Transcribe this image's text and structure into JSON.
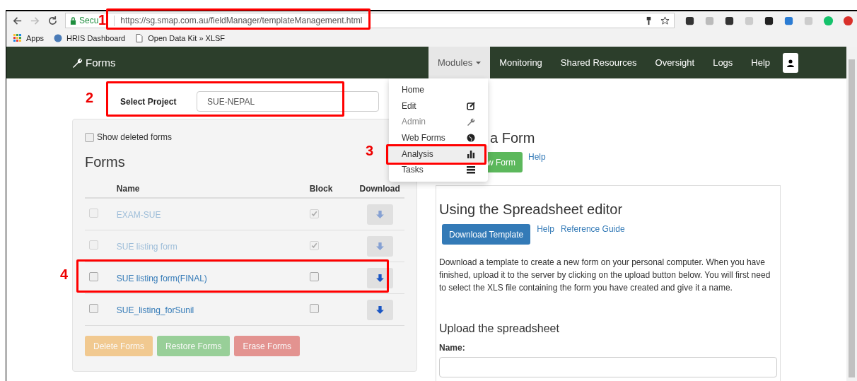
{
  "browser": {
    "secure_label": "Secu",
    "url": "https://sg.smap.com.au/fieldManager/templateManagement.html",
    "bookmarks": [
      "Apps",
      "HRIS Dashboard",
      "Open Data Kit » XLSF"
    ]
  },
  "navbar": {
    "brand": "Forms",
    "items": [
      {
        "label": "Modules",
        "kind": "dropdown",
        "expanded": true
      },
      {
        "label": "Monitoring",
        "kind": "link",
        "expanded": false
      },
      {
        "label": "Shared Resources",
        "kind": "link",
        "expanded": false
      },
      {
        "label": "Oversight",
        "kind": "link",
        "expanded": false
      },
      {
        "label": "Logs",
        "kind": "link",
        "expanded": false
      },
      {
        "label": "Help",
        "kind": "link",
        "expanded": false
      }
    ]
  },
  "modules_menu": [
    {
      "label": "Home",
      "disabled": false,
      "selected": false
    },
    {
      "label": "Edit",
      "disabled": false,
      "selected": false
    },
    {
      "label": "Admin",
      "disabled": true,
      "selected": false
    },
    {
      "label": "Web Forms",
      "disabled": false,
      "selected": false
    },
    {
      "label": "Analysis",
      "disabled": false,
      "selected": true
    },
    {
      "label": "Tasks",
      "disabled": false,
      "selected": false
    }
  ],
  "project": {
    "label": "Select Project",
    "value": "SUE-NEPAL"
  },
  "forms_panel": {
    "show_deleted": {
      "label": "Show deleted forms",
      "checked": false
    },
    "title": "Forms",
    "columns": [
      "Name",
      "Block",
      "Download"
    ],
    "rows": [
      {
        "name": "EXAM-SUE",
        "checked": false,
        "blocked": true
      },
      {
        "name": "SUE listing form",
        "checked": false,
        "blocked": true
      },
      {
        "name": "SUE listing form(FINAL)",
        "checked": false,
        "blocked": false
      },
      {
        "name": "SUE_listing_forSunil",
        "checked": false,
        "blocked": false
      }
    ],
    "buttons": [
      {
        "label": "Delete Forms",
        "kind": "warning",
        "disabled": true
      },
      {
        "label": "Restore Forms",
        "kind": "success",
        "disabled": true
      },
      {
        "label": "Erase Forms",
        "kind": "danger",
        "disabled": true
      }
    ]
  },
  "create": {
    "heading": "a Form",
    "button": "w Form",
    "help": "Help"
  },
  "editor_card": {
    "title": "Using the Spreadsheet editor",
    "button": "Download Template",
    "links": [
      "Help",
      "Reference Guide"
    ],
    "text": "Download a template to create a new form on your personal computer. When you have finished, upload it to the server by clicking on the upload button below. You will first need to select the XLS file containing the form you have created and give it a name.",
    "upload_title": "Upload the spreadsheet",
    "name_label": "Name:"
  },
  "annotations": [
    {
      "number": "1"
    },
    {
      "number": "2"
    },
    {
      "number": "3"
    },
    {
      "number": "4"
    }
  ]
}
